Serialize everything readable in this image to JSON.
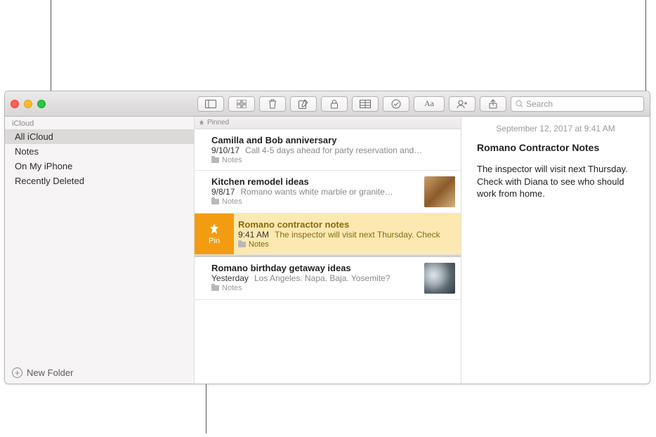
{
  "search": {
    "placeholder": "Search"
  },
  "sidebar": {
    "section": "iCloud",
    "items": [
      {
        "label": "All iCloud",
        "selected": true
      },
      {
        "label": "Notes",
        "selected": false
      },
      {
        "label": "On My iPhone",
        "selected": false
      },
      {
        "label": "Recently Deleted",
        "selected": false
      }
    ],
    "new_folder_label": "New Folder"
  },
  "list": {
    "pinned_label": "Pinned",
    "pin_action_label": "Pin",
    "notes": [
      {
        "title": "Camilla and Bob anniversary",
        "date": "9/10/17",
        "preview": "Call 4-5 days ahead for party reservation and…",
        "folder": "Notes",
        "pinned": true,
        "selected": false,
        "thumb": null
      },
      {
        "title": "Kitchen remodel ideas",
        "date": "9/8/17",
        "preview": "Romano wants white marble or granite…",
        "folder": "Notes",
        "pinned": true,
        "selected": false,
        "thumb": "wood"
      },
      {
        "title": "Romano contractor notes",
        "date": "9:41 AM",
        "preview": "The inspector will visit next Thursday. Check",
        "folder": "Notes",
        "pinned": true,
        "selected": true,
        "swipe_pin": true
      },
      {
        "title": "Romano birthday getaway ideas",
        "date": "Yesterday",
        "preview": "Los Angeles. Napa. Baja. Yosemite?",
        "folder": "Notes",
        "pinned": false,
        "selected": false,
        "thumb": "rocks"
      }
    ]
  },
  "note": {
    "date_line": "September 12, 2017 at 9:41 AM",
    "title": "Romano Contractor Notes",
    "body": "The inspector will visit next Thursday. Check with Diana to see who should work from home."
  },
  "toolbar_icons": [
    "sidebar-toggle-icon",
    "gallery-view-icon",
    "trash-icon",
    "compose-icon",
    "lock-icon",
    "table-icon",
    "checklist-icon",
    "format-icon",
    "add-people-icon",
    "share-icon"
  ]
}
